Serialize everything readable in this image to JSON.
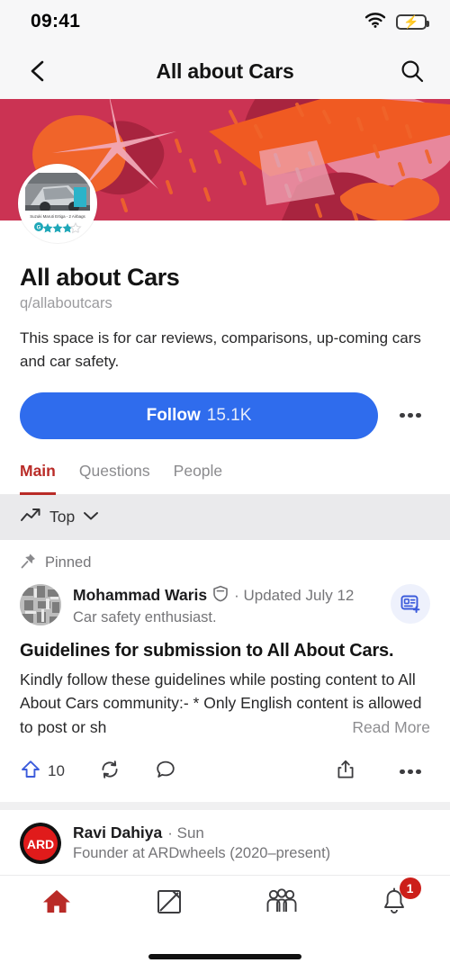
{
  "status_bar": {
    "time": "09:41",
    "wifi_icon": "wifi-icon",
    "battery_icon": "battery-charging-icon"
  },
  "header": {
    "back_icon": "back-chevron-icon",
    "title": "All about Cars",
    "search_icon": "search-icon"
  },
  "banner": {
    "name": "space-banner-image",
    "colors": {
      "background": "#cb3353",
      "dark_shape": "#a8243f",
      "orange": "#f05a22",
      "light_pink": "#e8879c"
    }
  },
  "avatar": {
    "name": "space-avatar",
    "caption": "Suzuki Maruti Ertiga - 2 Airbags",
    "stars": 3,
    "star_color": "#1fa7b8"
  },
  "profile": {
    "title": "All about Cars",
    "handle": "q/allaboutcars",
    "description": "This space is for car reviews, comparisons, up-coming cars and car safety.",
    "follow_label": "Follow",
    "follow_count": "15.1K",
    "follow_color": "#2f6ced",
    "more_icon": "three-dots-icon"
  },
  "tabs": [
    {
      "label": "Main",
      "active": true
    },
    {
      "label": "Questions",
      "active": false
    },
    {
      "label": "People",
      "active": false
    }
  ],
  "tab_accent": "#b92b27",
  "sort_bar": {
    "icon": "trending-up-icon",
    "label": "Top",
    "chevron_icon": "chevron-down-icon"
  },
  "feed": [
    {
      "pinned_label": "Pinned",
      "pin_icon": "pushpin-icon",
      "author": "Mohammad Waris",
      "badge_icon": "moderator-shield-icon",
      "time": "· Updated July 12",
      "credential": "Car safety enthusiast.",
      "subscribe_icon": "subscribe-feed-icon",
      "title": "Guidelines for submission to All About Cars.",
      "body": "Kindly follow these guidelines while posting content to All About Cars community:- * Only English content is allowed to post or sh",
      "read_more": "Read More",
      "upvote_icon": "upvote-arrow-icon",
      "upvote_count": "10",
      "repost_icon": "repost-icon",
      "comment_icon": "comment-bubble-icon",
      "share_icon": "share-icon",
      "more_icon": "three-dots-icon"
    },
    {
      "author": "Ravi Dahiya",
      "time": "· Sun",
      "credential": "Founder at ARDwheels (2020–present)",
      "avatar_text": "ARD",
      "avatar_color": "#e01b1b"
    }
  ],
  "bottom_nav": [
    {
      "icon": "home-icon",
      "active": true
    },
    {
      "icon": "compose-icon",
      "active": false
    },
    {
      "icon": "spaces-people-icon",
      "active": false
    },
    {
      "icon": "notifications-bell-icon",
      "active": false,
      "badge": "1"
    }
  ],
  "bottom_nav_active_color": "#b92b27"
}
